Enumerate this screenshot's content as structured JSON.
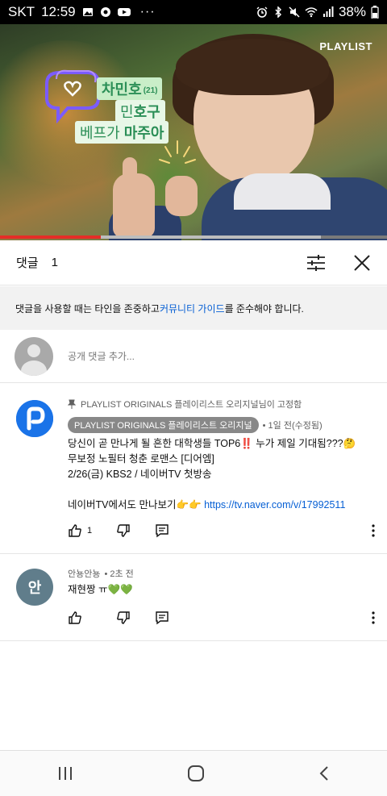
{
  "status_bar": {
    "carrier": "SKT",
    "time": "12:59",
    "ellipsis": "···",
    "battery": "38%"
  },
  "video": {
    "brand": "PLAYLIST",
    "overlay": {
      "name": "차민호",
      "age": "(21)",
      "nick_prefix": "민",
      "nick_suffix": "호구",
      "friend_prefix": "베프가",
      "friend_suffix": "마주아"
    },
    "progress_fraction": 0.26,
    "buffer_fraction": 0.83
  },
  "comments": {
    "title": "댓글",
    "count": "1",
    "guideline_prefix": "댓글을 사용할 때는 타인을 존중하고 ",
    "guideline_link": "커뮤니티 가이드",
    "guideline_suffix": "를 준수해야 합니다.",
    "add_placeholder": "공개 댓글 추가..."
  },
  "thread": [
    {
      "pinned_label": "PLAYLIST ORIGINALS 플레이리스트 오리지널님이 고정함",
      "author": "PLAYLIST ORIGINALS 플레이리스트 오리지널",
      "meta": "• 1일 전(수정됨)",
      "line1": "당신이 곧 만나게 될 흔한 대학생들 TOP6‼️ 누가 제일 기대됨???🤔",
      "line2": "무보정 노필터 청춘 로맨스 [디어엠]",
      "line3": "2/26(금) KBS2 / 네이버TV 첫방송",
      "line4_text": "네이버TV에서도 만나보기👉👉 ",
      "line4_link": "https://tv.naver.com/v/17992511",
      "likes": "1"
    },
    {
      "avatar_letter": "안",
      "author": "안뇽안뇽",
      "meta": "• 2초 전",
      "text": "재현짱 ㅠ💚💚"
    }
  ],
  "colors": {
    "accent_link": "#065fd4",
    "progress": "#e52d27",
    "avatar_playlist": "#1a73e8",
    "avatar_user": "#607d8b"
  },
  "icons": {
    "status_left": [
      "image-icon",
      "record-icon",
      "youtube-icon"
    ],
    "status_right": [
      "alarm-icon",
      "bluetooth-icon",
      "mute-icon",
      "wifi-icon",
      "signal-icon",
      "battery-icon"
    ],
    "nav": [
      "recents-icon",
      "home-icon",
      "back-icon"
    ]
  }
}
